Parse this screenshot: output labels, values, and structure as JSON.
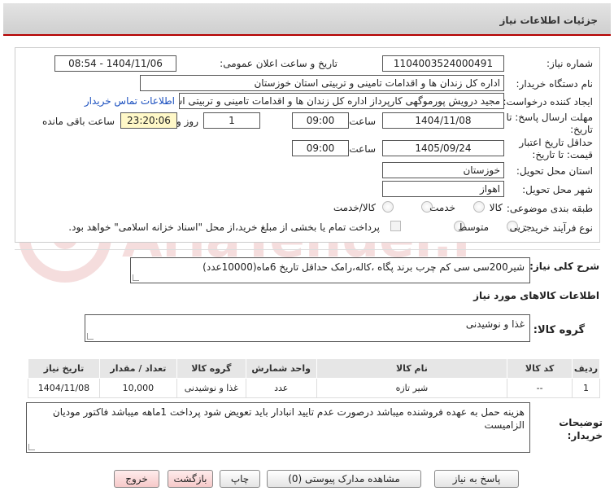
{
  "header": {
    "title": "جزئیات اطلاعات نیاز"
  },
  "form": {
    "need_number_label": "شماره نیاز:",
    "need_number": "1104003524000491",
    "announce_label": "تاریخ و ساعت اعلان عمومی:",
    "announce_value": "1404/11/06 - 08:54",
    "buyer_org_label": "نام دستگاه خریدار:",
    "buyer_org": "اداره کل زندان ها و اقدامات تامینی و تربیتی استان خوزستان",
    "creator_label": "ایجاد کننده درخواست:",
    "creator": "مجید درویش پورموگهی کارپرداز اداره کل زندان ها و اقدامات تامینی و تربیتی است",
    "contact_link": "اطلاعات تماس خریدار",
    "reply_deadline_label_1": "مهلت ارسال پاسخ: تا",
    "reply_deadline_label_2": "تاریخ:",
    "reply_date": "1404/11/08",
    "time_label": "ساعت",
    "reply_time": "09:00",
    "days": "1",
    "days_label": "روز و",
    "remaining_time": "23:20:06",
    "remaining_label": "ساعت باقی مانده",
    "price_validity_label_1": "حداقل تاریخ اعتبار",
    "price_validity_label_2": "قیمت: تا تاریخ:",
    "validity_date": "1405/09/24",
    "validity_time": "09:00",
    "province_label": "استان محل تحویل:",
    "province": "خوزستان",
    "city_label": "شهر محل تحویل:",
    "city": "اهواز",
    "category_label": "طبقه بندی موضوعی:",
    "category_options": [
      "کالا",
      "خدمت",
      "کالا/خدمت"
    ],
    "process_label": "نوع فرآیند خرید :",
    "process_options": [
      "جزیی",
      "متوسط"
    ],
    "payment_note": "پرداخت تمام یا بخشی از مبلغ خرید،از محل \"اسناد خزانه اسلامی\" خواهد بود."
  },
  "summary": {
    "label": "شرح کلی نیاز:",
    "text": "شیر200سی سی کم چرب برند پگاه ،کاله،رامک حداقل تاریخ 6ماه(10000عدد)"
  },
  "goods_section": {
    "title": "اطلاعات کالاهای مورد نیاز",
    "group_label": "گروه کالا:",
    "group_value": "غذا و نوشیدنی"
  },
  "table": {
    "headers": [
      "ردیف",
      "کد کالا",
      "نام کالا",
      "واحد شمارش",
      "گروه کالا",
      "تعداد / مقدار",
      "تاریخ نیاز"
    ],
    "rows": [
      [
        "1",
        "--",
        "شیر تازه",
        "عدد",
        "غذا و نوشیدنی",
        "10,000",
        "1404/11/08"
      ]
    ]
  },
  "notes": {
    "label_1": "توضیحات",
    "label_2": "خریدار:",
    "text": "هزینه حمل به عهده فروشنده میباشد درصورت عدم تایید انبادار باید تعویض شود پرداخت 1ماهه میباشد فاکتور مودیان الزامیست"
  },
  "buttons": {
    "reply": "پاسخ به نیاز",
    "docs": "مشاهده مدارک پیوستی (0)",
    "print": "چاپ",
    "back": "بازگشت",
    "exit": "خروج"
  },
  "watermark": {
    "text": "AriaTender.neT"
  }
}
